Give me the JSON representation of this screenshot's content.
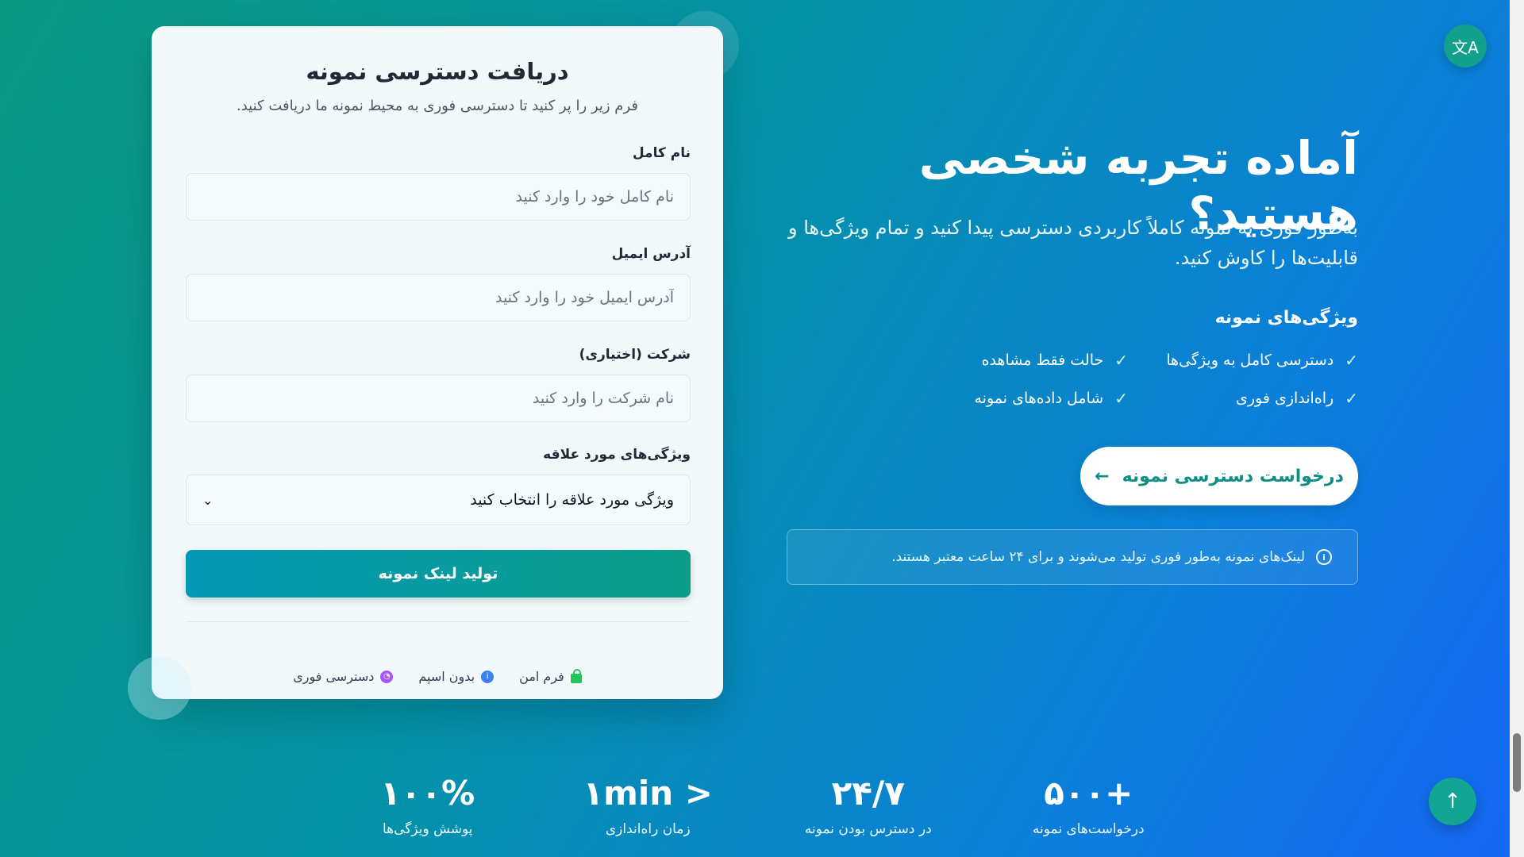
{
  "form": {
    "title": "دریافت دسترسی نمونه",
    "subtitle": "فرم زیر را پر کنید تا دسترسی فوری به محیط نمونه ما دریافت کنید.",
    "name_label": "نام کامل",
    "name_placeholder": "نام کامل خود را وارد کنید",
    "email_label": "آدرس ایمیل",
    "email_placeholder": "آدرس ایمیل خود را وارد کنید",
    "company_label": "شرکت (اختیاری)",
    "company_placeholder": "نام شرکت را وارد کنید",
    "interest_label": "ویژگی‌های مورد علاقه",
    "interest_selected": "ویژگی مورد علاقه را انتخاب کنید",
    "submit_label": "تولید لینک نمونه",
    "trust": [
      {
        "label": "فرم امن",
        "icon": "lock-icon",
        "color": "#22c55e"
      },
      {
        "label": "بدون اسپم",
        "icon": "info-icon",
        "color": "#3b82f6"
      },
      {
        "label": "دسترسی فوری",
        "icon": "clock-icon",
        "color": "#a855f7"
      }
    ]
  },
  "hero": {
    "title": "آماده تجربه شخصی هستید؟",
    "description": "به‌طور فوری به نمونه کاملاً کاربردی دسترسی پیدا کنید و تمام ویژگی‌ها و قابلیت‌ها را کاوش کنید.",
    "features_title": "ویژگی‌های نمونه",
    "features": [
      "دسترسی کامل به ویژگی‌ها",
      "حالت فقط مشاهده",
      "راه‌اندازی فوری",
      "شامل داده‌های نمونه"
    ],
    "cta_label": "درخواست دسترسی نمونه",
    "cta_arrow": "←",
    "notice": "لینک‌های نمونه به‌طور فوری تولید می‌شوند و برای ۲۴ ساعت معتبر هستند."
  },
  "stats": [
    {
      "value": "+۵۰۰",
      "label": "درخواست‌های نمونه"
    },
    {
      "value": "۲۴/۷",
      "label": "در دسترس بودن نمونه"
    },
    {
      "value": "< ۱min",
      "label": "زمان راه‌اندازی"
    },
    {
      "value": "۱۰۰%",
      "label": "پوشش ویژگی‌ها"
    }
  ],
  "buttons": {
    "language_icon": "translate-icon",
    "language_glyph": "文A",
    "scroll_top_icon": "arrow-up-icon",
    "scroll_top_glyph": "↑"
  },
  "colors": {
    "bg_start": "#0a9a82",
    "bg_end": "#1567f3",
    "accent": "#0d8f86",
    "card_bg": "#f3f9fb"
  }
}
